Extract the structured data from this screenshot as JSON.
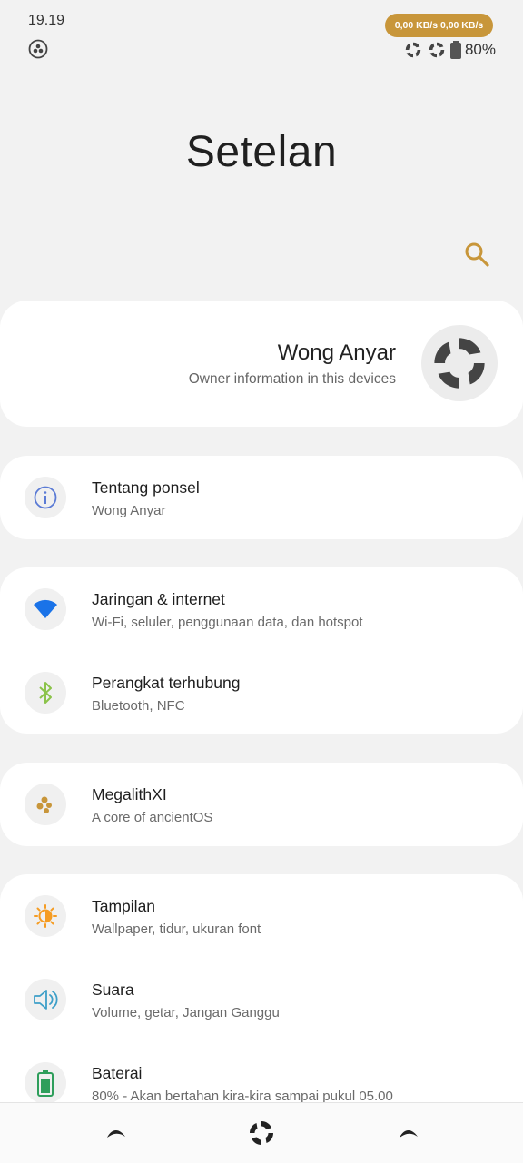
{
  "status": {
    "time": "19.19",
    "net_speed": "0,00 KB/s 0,00 KB/s",
    "battery": "80%"
  },
  "header": {
    "title": "Setelan"
  },
  "profile": {
    "name": "Wong Anyar",
    "subtitle": "Owner information in this devices"
  },
  "items": [
    {
      "title": "Tentang ponsel",
      "subtitle": "Wong Anyar",
      "icon": "info-icon",
      "color": "#5b7bd5"
    },
    {
      "title": "Jaringan & internet",
      "subtitle": "Wi-Fi, seluler, penggunaan data, dan hotspot",
      "icon": "wifi-icon",
      "color": "#1a73e8"
    },
    {
      "title": "Perangkat terhubung",
      "subtitle": "Bluetooth, NFC",
      "icon": "bluetooth-icon",
      "color": "#8bc34a"
    },
    {
      "title": "MegalithXI",
      "subtitle": "A core of ancientOS",
      "icon": "megalith-icon",
      "color": "#c8963a"
    },
    {
      "title": "Tampilan",
      "subtitle": "Wallpaper, tidur, ukuran font",
      "icon": "brightness-icon",
      "color": "#f59c23"
    },
    {
      "title": "Suara",
      "subtitle": "Volume, getar, Jangan Ganggu",
      "icon": "volume-icon",
      "color": "#3d9fc8"
    },
    {
      "title": "Baterai",
      "subtitle": "80% - Akan bertahan kira-kira sampai pukul 05.00",
      "icon": "battery-icon",
      "color": "#2e9e5b"
    }
  ],
  "accent": "#c8963a"
}
